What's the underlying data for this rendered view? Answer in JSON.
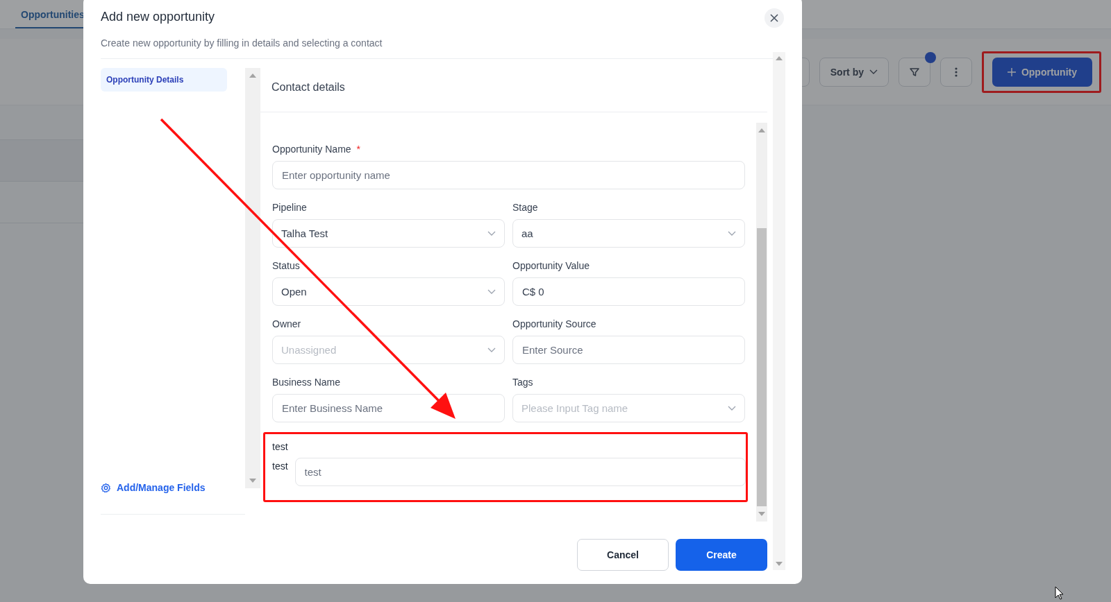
{
  "page": {
    "tab": {
      "label": "Opportunities",
      "selected": true
    },
    "toolbar": {
      "sort_button": "Sort by",
      "filter_active": true,
      "add_button": "Opportunity"
    }
  },
  "dialog": {
    "title": "Add new opportunity",
    "subtitle": "Create new opportunity by filling in details and selecting a contact",
    "nav": [
      {
        "label": "Opportunity Details",
        "selected": true
      }
    ],
    "section_title": "Contact details",
    "fields": [
      {
        "label": "Opportunity Name",
        "required_mark": "*",
        "kind": "input",
        "placeholder": "Enter opportunity name",
        "wide": true
      },
      {
        "label": "Pipeline",
        "kind": "select",
        "value": "Talha Test"
      },
      {
        "label": "Stage",
        "kind": "select",
        "value": "aa"
      },
      {
        "label": "Status",
        "kind": "select",
        "value": "Open"
      },
      {
        "label": "Opportunity Value",
        "kind": "input",
        "value": "C$ 0"
      },
      {
        "label": "Owner",
        "kind": "select",
        "placeholder": "Unassigned"
      },
      {
        "label": "Opportunity Source",
        "kind": "input",
        "placeholder": "Enter Source"
      },
      {
        "label": "Business Name",
        "kind": "input",
        "placeholder": "Enter Business Name"
      },
      {
        "label": "Tags",
        "kind": "select",
        "placeholder": "Please Input Tag name"
      }
    ],
    "custom_section": {
      "title": "test",
      "field_label": "test",
      "placeholder": "test"
    },
    "manage_link": "Add/Manage Fields",
    "buttons": {
      "cancel": "Cancel",
      "create": "Create"
    }
  }
}
